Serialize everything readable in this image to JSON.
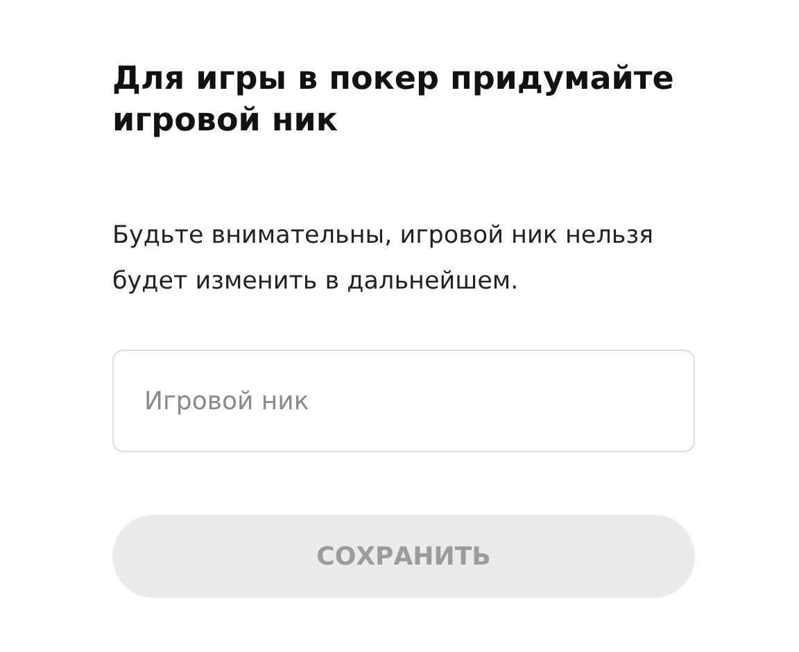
{
  "title": "Для игры в покер придумайте игровой ник",
  "description": "Будьте внимательны, игровой ник нельзя будет изменить в дальнейшем.",
  "nickname_field": {
    "placeholder": "Игровой ник"
  },
  "save_button": {
    "label": "СОХРАНИТЬ",
    "disabled": true
  }
}
